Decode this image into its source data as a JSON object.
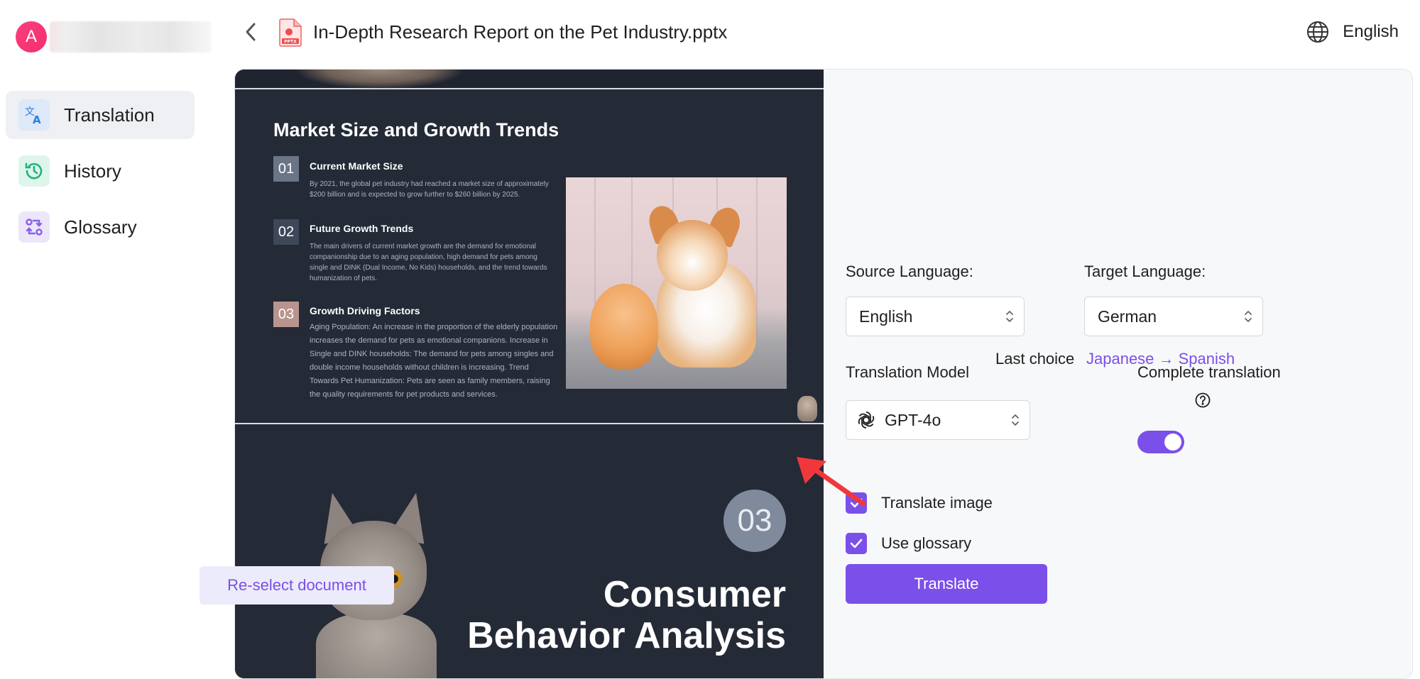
{
  "sidebar": {
    "avatar_initial": "A",
    "items": [
      {
        "label": "Translation",
        "icon": "translate-icon",
        "active": true
      },
      {
        "label": "History",
        "icon": "history-icon",
        "active": false
      },
      {
        "label": "Glossary",
        "icon": "glossary-icon",
        "active": false
      }
    ]
  },
  "header": {
    "document_title": "In-Depth Research Report on the Pet Industry.pptx",
    "file_badge": "PPTX",
    "ui_language": "English"
  },
  "preview": {
    "slide1": {
      "title": "Market Size and Growth Trends",
      "sections": [
        {
          "num": "01",
          "heading": "Current Market Size",
          "body": "By 2021, the global pet industry had reached a market size of approximately $200 billion and is expected to grow further to $260 billion by 2025."
        },
        {
          "num": "02",
          "heading": "Future Growth Trends",
          "body": "The main drivers of current market growth are the demand for emotional companionship due to an aging population, high demand for pets among single and DINK (Dual Income, No Kids) households, and the trend towards humanization of pets."
        },
        {
          "num": "03",
          "heading": "Growth Driving Factors",
          "body": "Aging Population: An increase in the proportion of the elderly population increases the demand for pets as emotional companions. Increase in Single and DINK households: The demand for pets among singles and double income households without children is increasing. Trend Towards Pet Humanization: Pets are seen as family members, raising the quality requirements for pet products and services."
        }
      ]
    },
    "slide2": {
      "num": "03",
      "title_line1": "Consumer",
      "title_line2": "Behavior Analysis"
    },
    "reselect_label": "Re-select document"
  },
  "settings": {
    "source_label": "Source Language:",
    "source_value": "English",
    "target_label": "Target Language:",
    "target_value": "German",
    "last_choice_label": "Last choice",
    "last_choice_value": "Japanese → Spanish",
    "model_label": "Translation Model",
    "model_value": "GPT-4o",
    "complete_label": "Complete translation",
    "complete_enabled": true,
    "translate_image_label": "Translate image",
    "translate_image_checked": true,
    "use_glossary_label": "Use glossary",
    "use_glossary_checked": true,
    "translate_button": "Translate"
  },
  "colors": {
    "accent": "#7b4fe9",
    "slide_bg": "#242a36",
    "annotation_arrow": "#f0383c"
  }
}
